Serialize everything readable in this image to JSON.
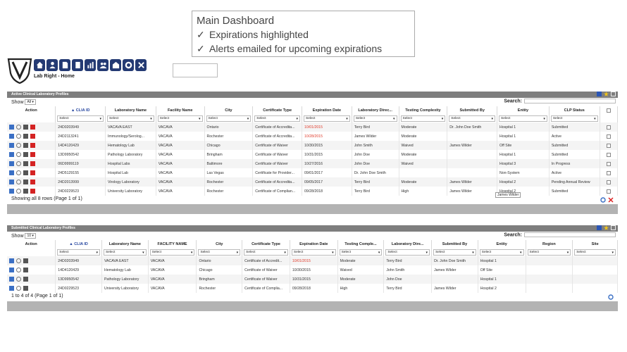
{
  "callout": {
    "title": "Main Dashboard",
    "items": [
      "Expirations highlighted",
      "Alerts emailed for upcoming expirations"
    ]
  },
  "app": {
    "title": "Lab Right - Home"
  },
  "toolbar_icons": [
    "home-icon",
    "user-icon",
    "document-icon",
    "file-icon",
    "chart-icon",
    "group-icon",
    "building-icon",
    "gear-icon",
    "close-icon"
  ],
  "active": {
    "title": "Active Clinical Laboratory Profiles",
    "show_label": "Show",
    "show_value": "All",
    "search_label": "Search:",
    "columns": [
      "Action",
      "CLIA ID",
      "Laboratory Name",
      "Facility Name",
      "City",
      "Certificate Type",
      "Expiration Date",
      "Laboratory Direc...",
      "Testing Complexity",
      "Submitted By",
      "Entity",
      "CLP Status"
    ],
    "filter_placeholder": "Select",
    "rows": [
      [
        "24D0203949",
        "VACAVA EAST",
        "VACAVA",
        "Ontario",
        "Certificate of Accredita...",
        "10/01/2015",
        "Terry Bird",
        "Moderate",
        "Dr. John Doe Smith",
        "Hospital 1",
        "Submitted"
      ],
      [
        "24D2113241",
        "Immunology/Serolog...",
        "VACAVA",
        "Rochester",
        "Certificate of Accredita...",
        "10/28/2015",
        "James Wilder",
        "Moderate",
        "",
        "Hospital 1",
        "Active"
      ],
      [
        "14D4120429",
        "Hematology Lab",
        "VACAVA",
        "Chicago",
        "Certificate of Waiver",
        "10/30/2015",
        "John Smith",
        "Waived",
        "James Wilder",
        "Off Site",
        "Submitted"
      ],
      [
        "13D9950542",
        "Pathology Laboratory",
        "VACAVA",
        "Bringham",
        "Certificate of Waiver",
        "10/31/2015",
        "John Doe",
        "Moderate",
        "",
        "Hospital 1",
        "Submitted"
      ],
      [
        "06D9999119",
        "Hospital Labs",
        "VACAVA",
        "Baltimore",
        "Certificate of Waiver",
        "10/27/2016",
        "John Doe",
        "Waived",
        "",
        "Hospital 3",
        "In Progress"
      ],
      [
        "24D5129155",
        "Hospital Lab",
        "VACAVA",
        "Las Vegas",
        "Certificate for Provider...",
        "09/01/2017",
        "Dr. John Doe Smith",
        "",
        "",
        "Non-System",
        "Active"
      ],
      [
        "24D2013999",
        "Virology Laboratory",
        "VACAVA",
        "Rochester",
        "Certificate of Accredita...",
        "09/05/2017",
        "Terry Bird",
        "Moderate",
        "James Wilder",
        "Hospital 2",
        "Pending Annual Review"
      ],
      [
        "24D0229523",
        "University Laboratory",
        "VACAVA",
        "Rochester",
        "Certificate of Complian...",
        "09/28/2018",
        "Terry Bird",
        "High",
        "James Wilder",
        "Hospital 2",
        "Submitted"
      ]
    ],
    "expiring_rows": [
      0,
      1
    ],
    "footer": "Showing all 8 rows (Page 1 of 1)",
    "tooltip": "James Wilder"
  },
  "submitted": {
    "title": "Submitted Clinical Laboratory Profiles",
    "show_label": "Show",
    "show_value": "10",
    "search_label": "Search:",
    "columns": [
      "Action",
      "CLIA ID",
      "Laboratory Name",
      "FACILITY NAME",
      "City",
      "Certificate Type",
      "Expiration Date",
      "Testing Comple...",
      "Laboratory Dire...",
      "Submitted By",
      "Entity",
      "Region",
      "Site"
    ],
    "filter_placeholder": "Select",
    "rows": [
      [
        "24D0203949",
        "VACAVA EAST",
        "VACAVA",
        "Ontario",
        "Certificate of Accredit...",
        "10/01/2015",
        "Moderate",
        "Terry Bird",
        "Dr. John Doe Smith",
        "Hospital 1",
        "",
        ""
      ],
      [
        "14D4120429",
        "Hematology Lab",
        "VACAVA",
        "Chicago",
        "Certificate of Waiver",
        "10/30/2015",
        "Waived",
        "John Smith",
        "James Wilder",
        "Off Site",
        "",
        ""
      ],
      [
        "13D9950542",
        "Pathology Laboratory",
        "VACAVA",
        "Bringham",
        "Certificate of Waiver",
        "10/31/2015",
        "Moderate",
        "John Doe",
        "",
        "Hospital 1",
        "",
        ""
      ],
      [
        "24D0229523",
        "University Laboratory",
        "VACAVA",
        "Rochester",
        "Certificate of Complia...",
        "09/28/2018",
        "High",
        "Terry Bird",
        "James Wilder",
        "Hospital 2",
        "",
        ""
      ]
    ],
    "expiring_rows": [
      0
    ],
    "footer": "1 to 4 of 4 (Page 1 of 1)"
  },
  "colors": {
    "toolbar": "#243a73",
    "panel_bar": "#7e7e7e",
    "expired_text": "#e03c2c",
    "sort_header": "#2747a0"
  }
}
